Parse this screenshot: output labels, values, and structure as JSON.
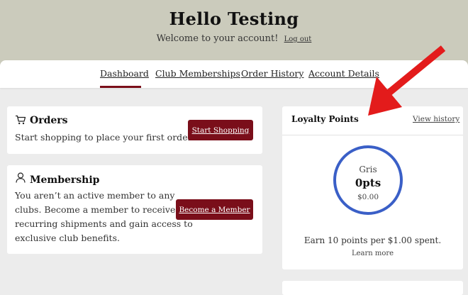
{
  "header": {
    "title": "Hello Testing",
    "welcome": "Welcome to your account!",
    "logout": "Log out"
  },
  "nav": {
    "tabs": [
      {
        "label": "Dashboard",
        "active": true
      },
      {
        "label": "Club Memberships"
      },
      {
        "label": "Order History"
      },
      {
        "label": "Account Details"
      }
    ]
  },
  "orders": {
    "icon": "cart-icon",
    "title": "Orders",
    "text": "Start shopping to place your first order.",
    "button": "Start Shopping"
  },
  "membership": {
    "icon": "user-icon",
    "title": "Membership",
    "text_lines": [
      "You aren’t an active member to any",
      "clubs. Become a member to receive",
      "recurring shipments and gain access to",
      "exclusive club benefits."
    ],
    "button": "Become a Member"
  },
  "loyalty": {
    "title": "Loyalty Points",
    "history": "View history",
    "tier": "Gris",
    "points": "0pts",
    "value": "$0.00",
    "earn_text": "Earn 10 points per $1.00 spent.",
    "learn_more": "Learn more"
  },
  "colors": {
    "accent": "#7a0e1a",
    "ring": "#3a5fc7",
    "header_bg": "#cbcbbc",
    "arrow": "#e31b1b"
  }
}
